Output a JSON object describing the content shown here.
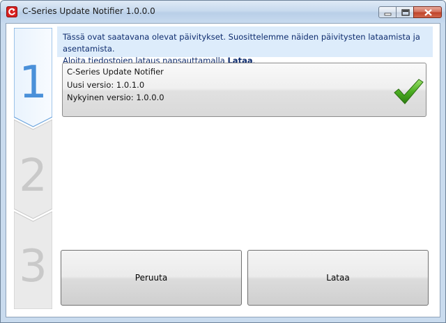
{
  "window": {
    "title": "C-Series Update Notifier 1.0.0.0",
    "icon": "app-refresh-icon",
    "controls": [
      "minimize-icon",
      "maximize-icon",
      "close-icon"
    ]
  },
  "steps": [
    "1",
    "2",
    "3"
  ],
  "info": {
    "line1": "Tässä ovat saatavana olevat päivitykset. Suosittelemme näiden päivitysten lataamista ja asentamista.",
    "line2_prefix": "Aloita tiedostojen lataus napsauttamalla ",
    "line2_bold": "Lataa",
    "line2_suffix": "."
  },
  "update": {
    "name": "C-Series Update Notifier",
    "new_version": "Uusi versio: 1.0.1.0",
    "current_version": "Nykyinen versio: 1.0.0.0",
    "status_icon": "checkmark-icon"
  },
  "buttons": {
    "cancel": "Peruuta",
    "download": "Lataa"
  },
  "colors": {
    "active_step": "#4a90d9",
    "banner_bg": "#ddecfb",
    "check": "#3a9a1a"
  }
}
